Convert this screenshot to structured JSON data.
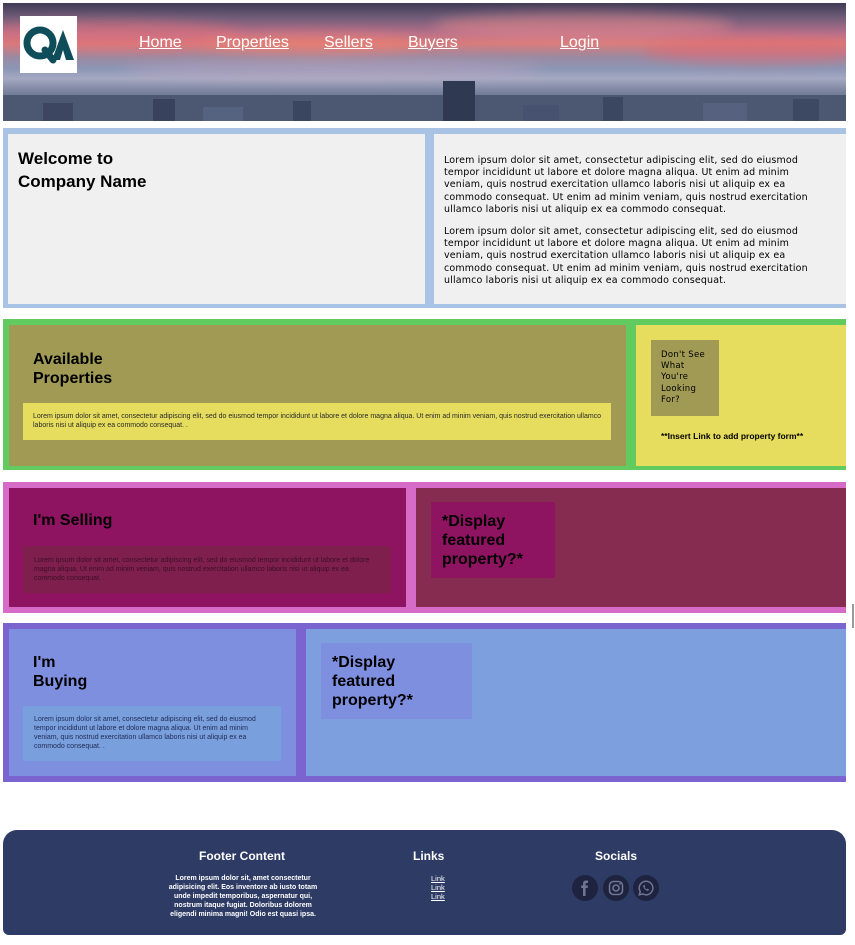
{
  "header": {
    "logo_text": "QA",
    "nav": [
      {
        "label": "Home"
      },
      {
        "label": "Properties"
      },
      {
        "label": "Sellers"
      },
      {
        "label": "Buyers"
      },
      {
        "label": "Login"
      }
    ]
  },
  "welcome": {
    "title_line1": "Welcome to",
    "title_line2": "Company Name",
    "paragraphs": [
      "Lorem ipsum dolor sit amet, consectetur adipiscing elit, sed do eiusmod tempor incididunt ut labore et dolore magna aliqua. Ut enim ad minim veniam, quis nostrud exercitation ullamco laboris nisi ut aliquip ex ea commodo consequat. Ut enim ad minim veniam, quis nostrud exercitation ullamco laboris nisi ut aliquip ex ea commodo consequat.",
      "Lorem ipsum dolor sit amet, consectetur adipiscing elit, sed do eiusmod tempor incididunt ut labore et dolore magna aliqua. Ut enim ad minim veniam, quis nostrud exercitation ullamco laboris nisi ut aliquip ex ea commodo consequat. Ut enim ad minim veniam, quis nostrud exercitation ullamco laboris nisi ut aliquip ex ea commodo consequat."
    ]
  },
  "properties": {
    "title_line1": "Available",
    "title_line2": "Properties",
    "text": "Lorem ipsum dolor sit amet, consectetur adipiscing elit, sed do eiusmod tempor incididunt ut labore et dolore magna aliqua. Ut enim ad minim veniam, quis nostrud exercitation ullamco laboris nisi ut aliquip ex ea commodo consequat. .",
    "lookfor_lines": [
      "Don't See",
      "What",
      "You're",
      "Looking",
      "For?"
    ],
    "insert_link": "**Insert Link to add property form**"
  },
  "selling": {
    "title": "I'm Selling",
    "text": "Lorem ipsum dolor sit amet, consectetur adipiscing elit, sed do eiusmod tempor incididunt ut labore et dolore magna aliqua. Ut enim ad minim veniam, quis nostrud exercitation ullamco laboris nisi ut aliquip ex ea commodo consequat. .",
    "featured_lines": [
      "*Display",
      "featured",
      "property?*"
    ]
  },
  "buying": {
    "title_line1": "I'm",
    "title_line2": "Buying",
    "text": "Lorem ipsum dolor sit amet, consectetur adipiscing elit, sed do eiusmod tempor incididunt ut labore et dolore magna aliqua. Ut enim ad minim veniam, quis nostrud exercitation ullamco laboris nisi ut aliquip ex ea commodo consequat. .",
    "featured_lines": [
      "*Display",
      "featured",
      "property?*"
    ]
  },
  "footer": {
    "content_heading": "Footer Content",
    "content_text": "Lorem ipsum dolor sit, amet consectetur adipisicing elit. Eos inventore ab iusto totam unde impedit temporibus, aspernatur qui, nostrum itaque fugiat. Doloribus dolorem eligendi minima magni! Odio est quasi ipsa.",
    "links_heading": "Links",
    "links": [
      "Link",
      "Link",
      "Link"
    ],
    "socials_heading": "Socials",
    "socials": [
      "facebook-icon",
      "instagram-icon",
      "whatsapp-icon"
    ]
  },
  "colors": {
    "welcome_border": "#a8c3e3",
    "properties_border": "#61cb60",
    "properties_panel": "#a09a55",
    "properties_accent": "#e6dd5e",
    "selling_border": "#d66bc8",
    "selling_panel": "#8e1361",
    "featured_panel_1": "#852c50",
    "buying_border": "#7b64cf",
    "buying_panel": "#7e8fe0",
    "featured_panel_2": "#7e9fde",
    "footer_bg": "#2e3b65",
    "logo_color": "#0f4d5a"
  }
}
